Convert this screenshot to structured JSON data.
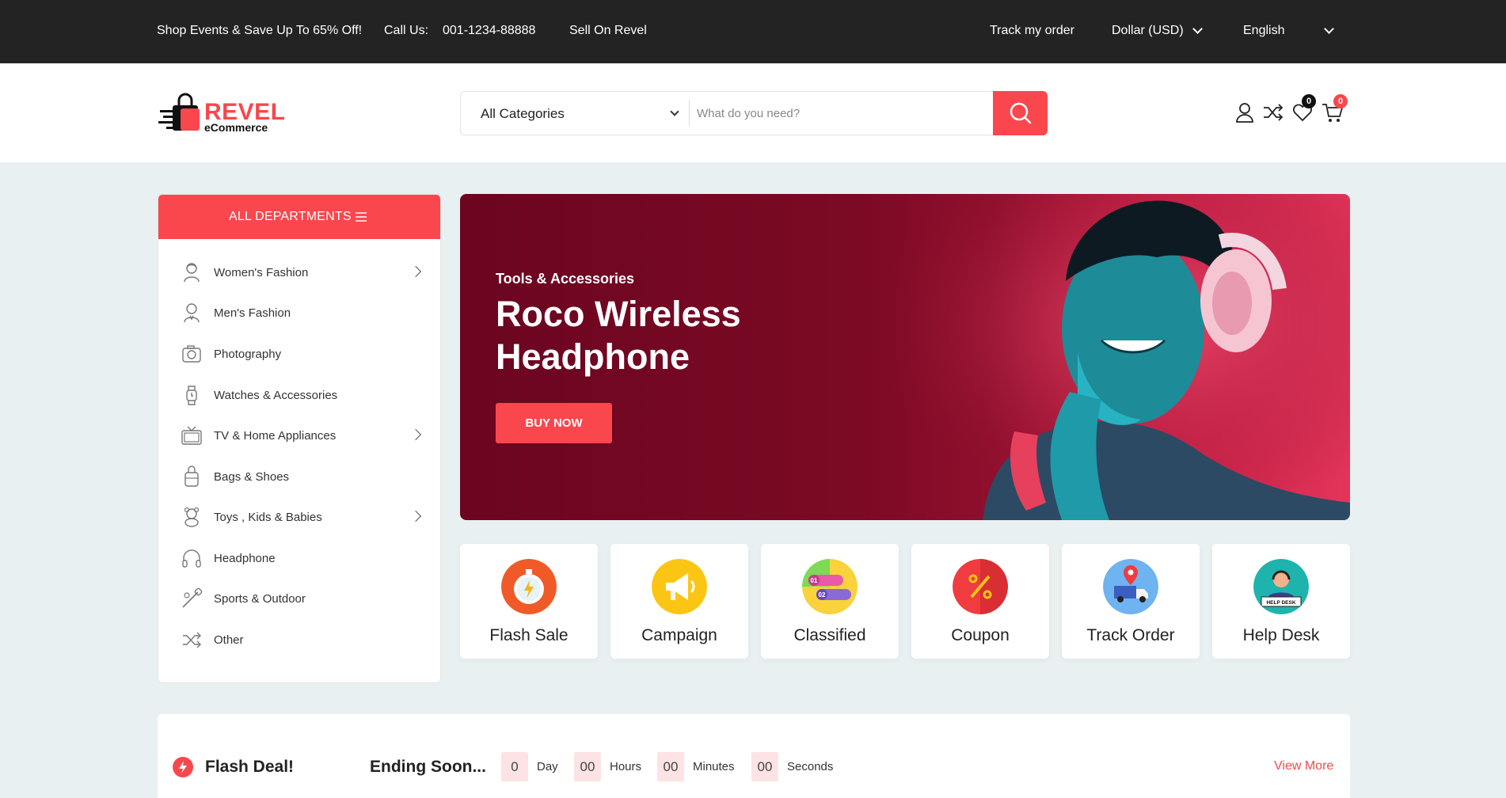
{
  "topbar": {
    "promo": "Shop Events & Save Up To 65% Off!",
    "call_label": "Call Us:",
    "phone": "001-1234-88888",
    "sell": "Sell On Revel",
    "track": "Track my order",
    "currency": "Dollar (USD)",
    "language": "English"
  },
  "header": {
    "logo_title": "REVEL",
    "logo_sub": "eCommerce",
    "category_selected": "All Categories",
    "search_placeholder": "What do you need?",
    "wishlist_count": "0",
    "cart_count": "0"
  },
  "sidebar": {
    "title": "ALL DEPARTMENTS",
    "items": [
      {
        "label": "Women's Fashion",
        "icon": "woman-icon",
        "has_submenu": true
      },
      {
        "label": "Men's Fashion",
        "icon": "man-icon",
        "has_submenu": false
      },
      {
        "label": "Photography",
        "icon": "camera-icon",
        "has_submenu": false
      },
      {
        "label": "Watches & Accessories",
        "icon": "watch-icon",
        "has_submenu": false
      },
      {
        "label": "TV & Home Appliances",
        "icon": "tv-icon",
        "has_submenu": true
      },
      {
        "label": "Bags & Shoes",
        "icon": "bag-icon",
        "has_submenu": false
      },
      {
        "label": "Toys , Kids & Babies",
        "icon": "teddy-bear-icon",
        "has_submenu": true
      },
      {
        "label": "Headphone",
        "icon": "headphone-icon",
        "has_submenu": false
      },
      {
        "label": "Sports & Outdoor",
        "icon": "sports-icon",
        "has_submenu": false
      },
      {
        "label": "Other",
        "icon": "shuffle-icon",
        "has_submenu": false
      }
    ]
  },
  "banner": {
    "subtitle": "Tools & Accessories",
    "title": "Roco Wireless Headphone",
    "button": "BUY NOW"
  },
  "features": [
    {
      "label": "Flash Sale",
      "icon": "stopwatch-icon"
    },
    {
      "label": "Campaign",
      "icon": "megaphone-icon"
    },
    {
      "label": "Classified",
      "icon": "list-icon"
    },
    {
      "label": "Coupon",
      "icon": "percent-icon"
    },
    {
      "label": "Track Order",
      "icon": "delivery-truck-icon"
    },
    {
      "label": "Help Desk",
      "icon": "help-desk-icon"
    }
  ],
  "flash_deal": {
    "title": "Flash Deal!",
    "ending": "Ending Soon...",
    "days": "0",
    "days_label": "Day",
    "hours": "00",
    "hours_label": "Hours",
    "minutes": "00",
    "minutes_label": "Minutes",
    "seconds": "00",
    "seconds_label": "Seconds",
    "view_more": "View More"
  },
  "colors": {
    "accent": "#f9474d",
    "topbar": "#232323",
    "banner": "#7c0a24"
  }
}
